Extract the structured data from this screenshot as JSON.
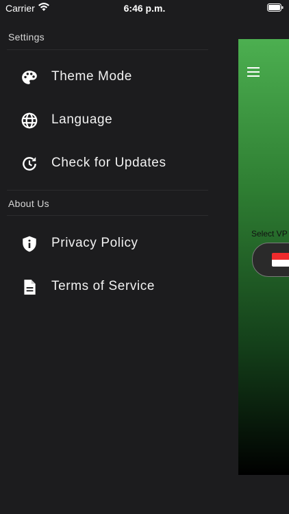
{
  "status_bar": {
    "carrier": "Carrier",
    "time": "6:46 p.m."
  },
  "drawer": {
    "settings_header": "Settings",
    "settings_items": [
      {
        "label": "Theme Mode",
        "icon": "palette-icon"
      },
      {
        "label": "Language",
        "icon": "globe-icon"
      },
      {
        "label": "Check for Updates",
        "icon": "update-icon"
      }
    ],
    "about_header": "About Us",
    "about_items": [
      {
        "label": "Privacy Policy",
        "icon": "shield-info-icon"
      },
      {
        "label": "Terms of Service",
        "icon": "document-icon"
      }
    ]
  },
  "main": {
    "select_label": "Select VP",
    "server_country": "Singapore"
  },
  "colors": {
    "drawer_bg": "#1c1c1e",
    "gradient_top": "#4caf50",
    "gradient_bottom": "#000000",
    "flag_red": "#ef2b2d"
  }
}
